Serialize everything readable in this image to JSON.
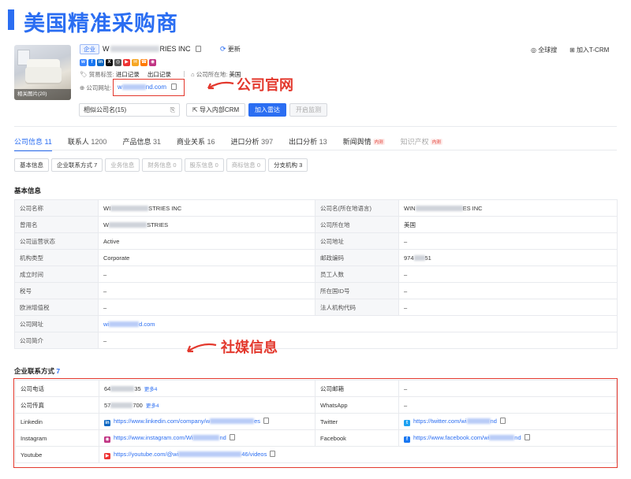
{
  "banner": {
    "title": "美国精准采购商"
  },
  "company": {
    "tag": "企业",
    "name_prefix": "W",
    "name_suffix": "RIES INC",
    "update": "更新",
    "photo_caption": "相关图片(20)",
    "trade_tags_label": "贸易标签:",
    "trade_tags": [
      "进口记录",
      "出口记录"
    ],
    "country_label": "公司所在地:",
    "country": "美国",
    "site_label": "公司网址:",
    "site_prefix": "w",
    "site_suffix": "nd.com"
  },
  "annotations": {
    "website": "公司官网",
    "social": "社媒信息"
  },
  "top_actions": {
    "global_search": "全球搜",
    "add_crm": "加入T-CRM"
  },
  "toolbar": {
    "similar": "相似公司名(15)",
    "import_crm": "导入内部CRM",
    "add_radar": "加入雷达",
    "open_monitor": "开启监测"
  },
  "tabs": [
    {
      "label": "公司信息",
      "count": "11",
      "active": true
    },
    {
      "label": "联系人",
      "count": "1200"
    },
    {
      "label": "产品信息",
      "count": "31"
    },
    {
      "label": "商业关系",
      "count": "16"
    },
    {
      "label": "进口分析",
      "count": "397"
    },
    {
      "label": "出口分析",
      "count": "13"
    },
    {
      "label": "新闻舆情",
      "count": "",
      "hot": "内测"
    },
    {
      "label": "知识产权",
      "count": "",
      "hot": "内测",
      "muted": true
    }
  ],
  "subtabs": [
    {
      "label": "基本信息"
    },
    {
      "label": "企业联系方式 7"
    },
    {
      "label": "业务信息",
      "disabled": true
    },
    {
      "label": "财务信息 0",
      "disabled": true
    },
    {
      "label": "股东信息 0",
      "disabled": true
    },
    {
      "label": "商标信息 0",
      "disabled": true
    },
    {
      "label": "分支机构 3"
    }
  ],
  "basic": {
    "title": "基本信息",
    "rows": [
      {
        "k1": "公司名称",
        "v1a": "WI",
        "v1b": "STRIES INC",
        "k2": "公司名(所在地语言)",
        "v2a": "WIN",
        "v2b": "ES INC"
      },
      {
        "k1": "曾用名",
        "v1a": "W",
        "v1b": "STRIES",
        "k2": "公司所在地",
        "v2": "美国"
      },
      {
        "k1": "公司运营状态",
        "v1": "Active",
        "k2": "公司地址",
        "v2": "–"
      },
      {
        "k1": "机构类型",
        "v1": "Corporate",
        "k2": "邮政编码",
        "v2a": "974",
        "v2b": "51"
      },
      {
        "k1": "成立时间",
        "v1": "–",
        "k2": "员工人数",
        "v2": "–"
      },
      {
        "k1": "税号",
        "v1": "–",
        "k2": "所在国ID号",
        "v2": "–"
      },
      {
        "k1": "欧洲增值税",
        "v1": "–",
        "k2": "法人机构代码",
        "v2": "–"
      }
    ],
    "website_label": "公司网址",
    "website_a": "wi",
    "website_b": "d.com",
    "intro_label": "公司简介",
    "intro": "–"
  },
  "contact": {
    "title": "企业联系方式",
    "count": "7",
    "phone_label": "公司电话",
    "phone_a": "64",
    "phone_b": "35",
    "phone_more": "更多4",
    "email_label": "公司邮箱",
    "email": "–",
    "fax_label": "公司传真",
    "fax_a": "57",
    "fax_b": "700",
    "fax_more": "更多4",
    "whatsapp_label": "WhatsApp",
    "whatsapp": "–",
    "linkedin_label": "Linkedin",
    "linkedin_a": "https://www.linkedin.com/company/w",
    "linkedin_b": "es",
    "twitter_label": "Twitter",
    "twitter_a": "https://twitter.com/wi",
    "twitter_b": "nd",
    "instagram_label": "Instagram",
    "instagram_a": "https://www.instagram.com/Wi",
    "instagram_b": "nd",
    "facebook_label": "Facebook",
    "facebook_a": "https://www.facebook.com/wi",
    "facebook_b": "nd",
    "youtube_label": "Youtube",
    "youtube_a": "https://youtube.com/@wi",
    "youtube_b": "46/videos"
  },
  "colors": {
    "brand": "#2b6ef2",
    "annotation": "#e3382d"
  }
}
